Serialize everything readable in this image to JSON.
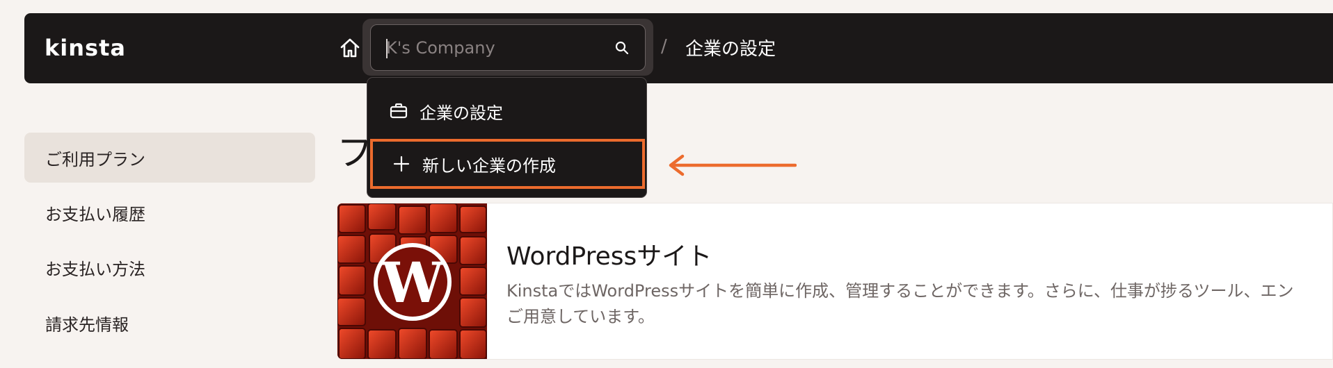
{
  "app": {
    "logo_text": "kinsta"
  },
  "header": {
    "search": {
      "value": "",
      "placeholder": "K's Company"
    },
    "separator": "/",
    "breadcrumb_current": "企業の設定"
  },
  "dropdown": {
    "items": [
      {
        "label": "企業の設定",
        "icon": "briefcase-icon"
      },
      {
        "label": "新しい企業の作成",
        "icon": "plus-icon",
        "highlighted": true
      }
    ]
  },
  "sidebar": {
    "items": [
      {
        "label": "ご利用プラン",
        "active": true
      },
      {
        "label": "お支払い履歴",
        "active": false
      },
      {
        "label": "お支払い方法",
        "active": false
      },
      {
        "label": "請求先情報",
        "active": false
      }
    ]
  },
  "main": {
    "page_title_partial": "フ",
    "card": {
      "title": "WordPressサイト",
      "description_line1": "KinstaではWordPressサイトを簡単に作成、管理することができます。さらに、仕事が捗るツール、エン",
      "description_line2": "ご用意しています。"
    }
  },
  "colors": {
    "topbar": "#1b1818",
    "accent_orange": "#ec6b2d",
    "background": "#f7f3f0"
  }
}
